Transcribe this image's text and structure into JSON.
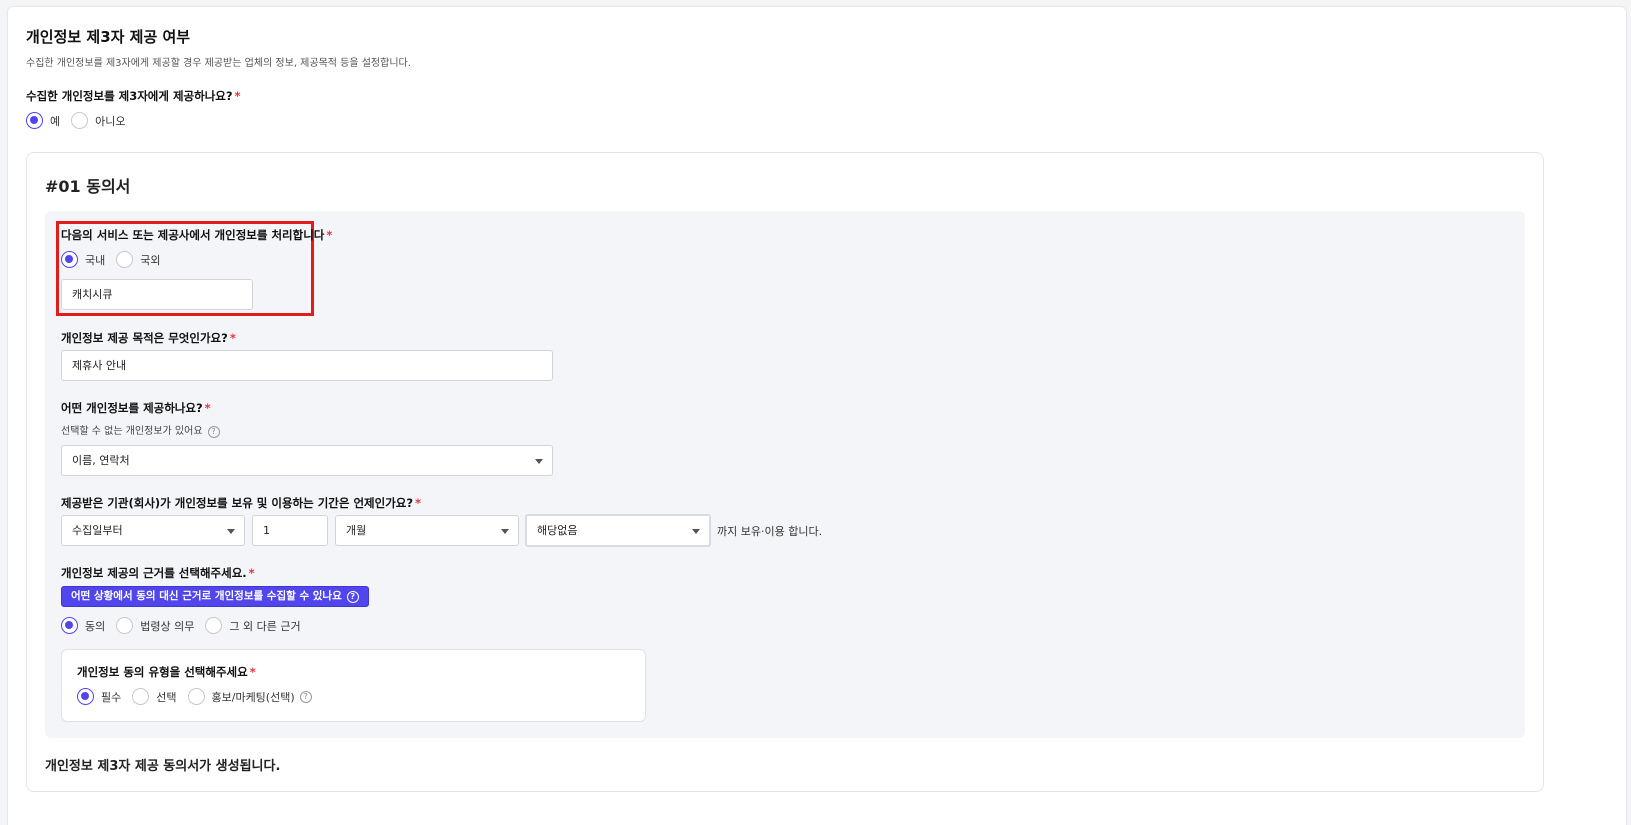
{
  "section": {
    "title": "개인정보 제3자 제공 여부",
    "description": "수집한 개인정보를 제3자에게 제공할 경우 제공받는 업체의 정보, 제공목적 등을 설정합니다.",
    "question": "수집한 개인정보를 제3자에게 제공하나요?",
    "required_mark": "*",
    "options": {
      "yes": "예",
      "no": "아니오"
    }
  },
  "consent": {
    "title": "#01 동의서",
    "processor": {
      "question": "다음의 서비스 또는 제공사에서 개인정보를 처리합니다",
      "options": {
        "domestic": "국내",
        "overseas": "국외"
      },
      "value": "캐치시큐"
    },
    "purpose": {
      "question": "개인정보 제공 목적은 무엇인가요?",
      "value": "제휴사 안내"
    },
    "items": {
      "question": "어떤 개인정보를 제공하나요?",
      "sub": "선택할 수 없는 개인정보가 있어요",
      "value": "이름, 연락처"
    },
    "period": {
      "question": "제공받은 기관(회사)가 개인정보를 보유 및 이용하는 기간은 언제인가요?",
      "start": "수집일부터",
      "amount": "1",
      "unit": "개월",
      "extra": "해당없음",
      "suffix": "까지 보유·이용 합니다."
    },
    "basis": {
      "question": "개인정보 제공의 근거를 선택해주세요.",
      "button": "어떤 상황에서 동의 대신 근거로 개인정보를 수집할 수 있나요",
      "options": {
        "consent": "동의",
        "legal": "법령상 의무",
        "other": "그 외 다른 근거"
      }
    },
    "consent_type": {
      "question": "개인정보 동의 유형을 선택해주세요",
      "options": {
        "required": "필수",
        "optional": "선택",
        "marketing": "홍보/마케팅(선택)"
      }
    },
    "footer": "개인정보 제3자 제공 동의서가 생성됩니다."
  },
  "colors": {
    "accent": "#5146ec",
    "required": "#e8343c",
    "highlight": "#e21b1b"
  },
  "icons": {
    "help": "question-circle-icon",
    "caret": "chevron-down-icon"
  }
}
